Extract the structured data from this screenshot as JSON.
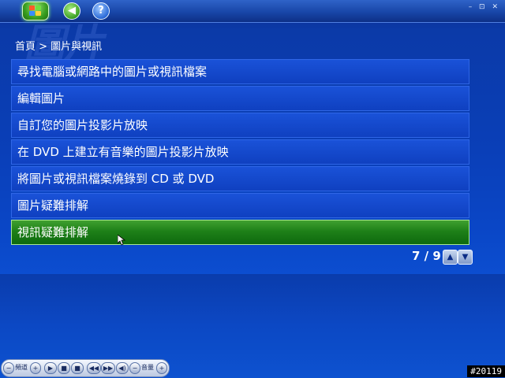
{
  "topbar": {
    "back_glyph": "◀",
    "help_glyph": "?",
    "window_controls": "– ⊡ ✕"
  },
  "watermark": "圖片",
  "breadcrumb": "首頁 > 圖片與視訊",
  "menu": {
    "items": [
      {
        "label": "尋找電腦或網路中的圖片或視訊檔案"
      },
      {
        "label": "編輯圖片"
      },
      {
        "label": "自訂您的圖片投影片放映"
      },
      {
        "label": "在 DVD 上建立有音樂的圖片投影片放映"
      },
      {
        "label": "將圖片或視訊檔案燒錄到 CD 或 DVD"
      },
      {
        "label": "圖片疑難排解"
      },
      {
        "label": "視訊疑難排解",
        "selected": true
      }
    ]
  },
  "pager": {
    "text": "7 / 9",
    "up_glyph": "▲",
    "down_glyph": "▼"
  },
  "transport": {
    "channel_label": "頻道",
    "volume_label": "音量",
    "play_glyph": "▶",
    "stop_glyph": "■",
    "rewind_glyph": "◀◀",
    "forward_glyph": "▶▶",
    "mute_glyph": "◀)",
    "minus_glyph": "−",
    "plus_glyph": "+"
  },
  "frame_id": "#20119",
  "colors": {
    "background": "#0a3fb8",
    "menu_item": "#1448cc",
    "selected_item": "#1e8018",
    "text": "#ffffff"
  }
}
